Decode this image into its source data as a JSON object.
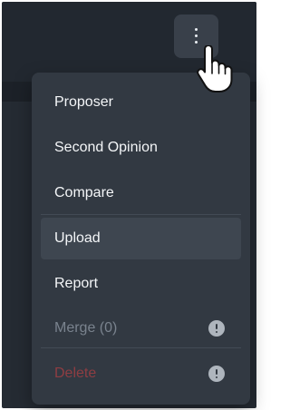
{
  "toolbar": {
    "more_icon": "kebab-vertical-icon"
  },
  "menu": {
    "items": [
      {
        "label": "Proposer",
        "state": "normal"
      },
      {
        "label": "Second Opinion",
        "state": "normal"
      },
      {
        "label": "Compare",
        "state": "normal"
      },
      {
        "label": "Upload",
        "state": "hovered"
      },
      {
        "label": "Report",
        "state": "normal"
      },
      {
        "label": "Merge (0)",
        "state": "disabled",
        "icon": "warning-circle-icon"
      },
      {
        "label": "Delete",
        "state": "disabled-danger",
        "icon": "warning-circle-icon"
      }
    ]
  },
  "colors": {
    "background": "#252b33",
    "menu_background": "#323942",
    "hover_background": "#3e4650",
    "text": "#f4f6f8",
    "disabled_text": "#7a838e",
    "danger_text": "#8f3d42"
  },
  "cursor": {
    "icon": "hand-pointer-icon"
  }
}
